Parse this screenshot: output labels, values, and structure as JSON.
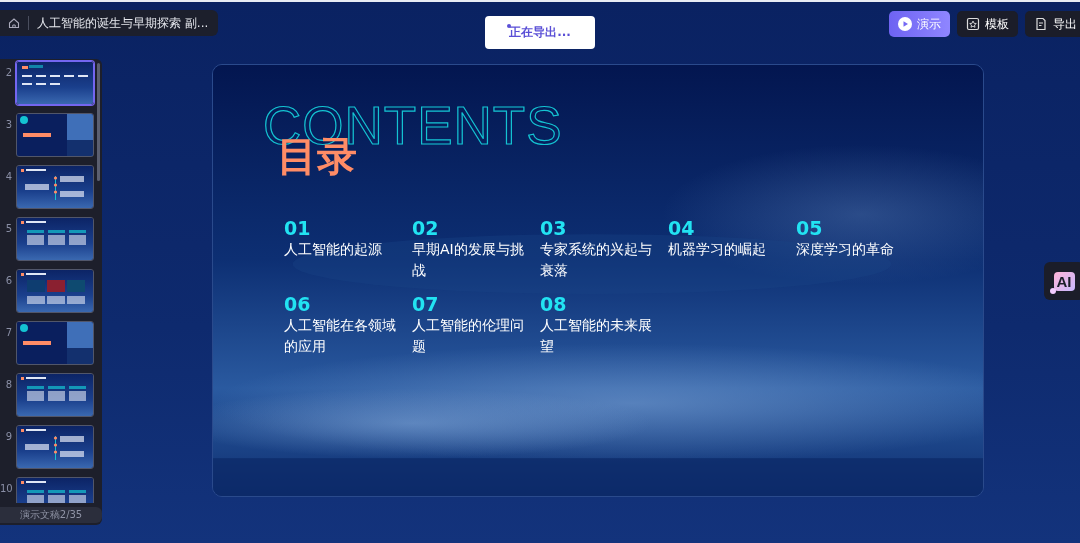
{
  "header": {
    "document_title": "人工智能的诞生与早期探索 副..."
  },
  "export_toast": {
    "text": "正在导出..."
  },
  "toolbar": {
    "buttons": [
      {
        "label": "演示",
        "kind": "primary"
      },
      {
        "label": "模板",
        "kind": "template"
      },
      {
        "label": "导出",
        "kind": "export"
      }
    ]
  },
  "slide_panel": {
    "slides": [
      {
        "number": "2",
        "kind": "contents",
        "selected": true
      },
      {
        "number": "3",
        "kind": "section",
        "selected": false
      },
      {
        "number": "4",
        "kind": "timeline",
        "selected": false
      },
      {
        "number": "5",
        "kind": "columns",
        "selected": false
      },
      {
        "number": "6",
        "kind": "images",
        "selected": false
      },
      {
        "number": "7",
        "kind": "section",
        "selected": false
      },
      {
        "number": "8",
        "kind": "columns",
        "selected": false
      },
      {
        "number": "9",
        "kind": "timeline",
        "selected": false
      },
      {
        "number": "10",
        "kind": "columns",
        "selected": false
      }
    ],
    "footer": "演示文稿2/35"
  },
  "slide": {
    "heading_en": "CONTENTS",
    "heading": "目录",
    "items": [
      {
        "number": "01",
        "title": "人工智能的起源"
      },
      {
        "number": "02",
        "title": "早期AI的发展与挑战"
      },
      {
        "number": "03",
        "title": "专家系统的兴起与衰落"
      },
      {
        "number": "04",
        "title": "机器学习的崛起"
      },
      {
        "number": "05",
        "title": "深度学习的革命"
      },
      {
        "number": "06",
        "title": "人工智能在各领域的应用"
      },
      {
        "number": "07",
        "title": "人工智能的伦理问题"
      },
      {
        "number": "08",
        "title": "人工智能的未来展望"
      }
    ]
  },
  "ai_button": {
    "label": "AI"
  }
}
